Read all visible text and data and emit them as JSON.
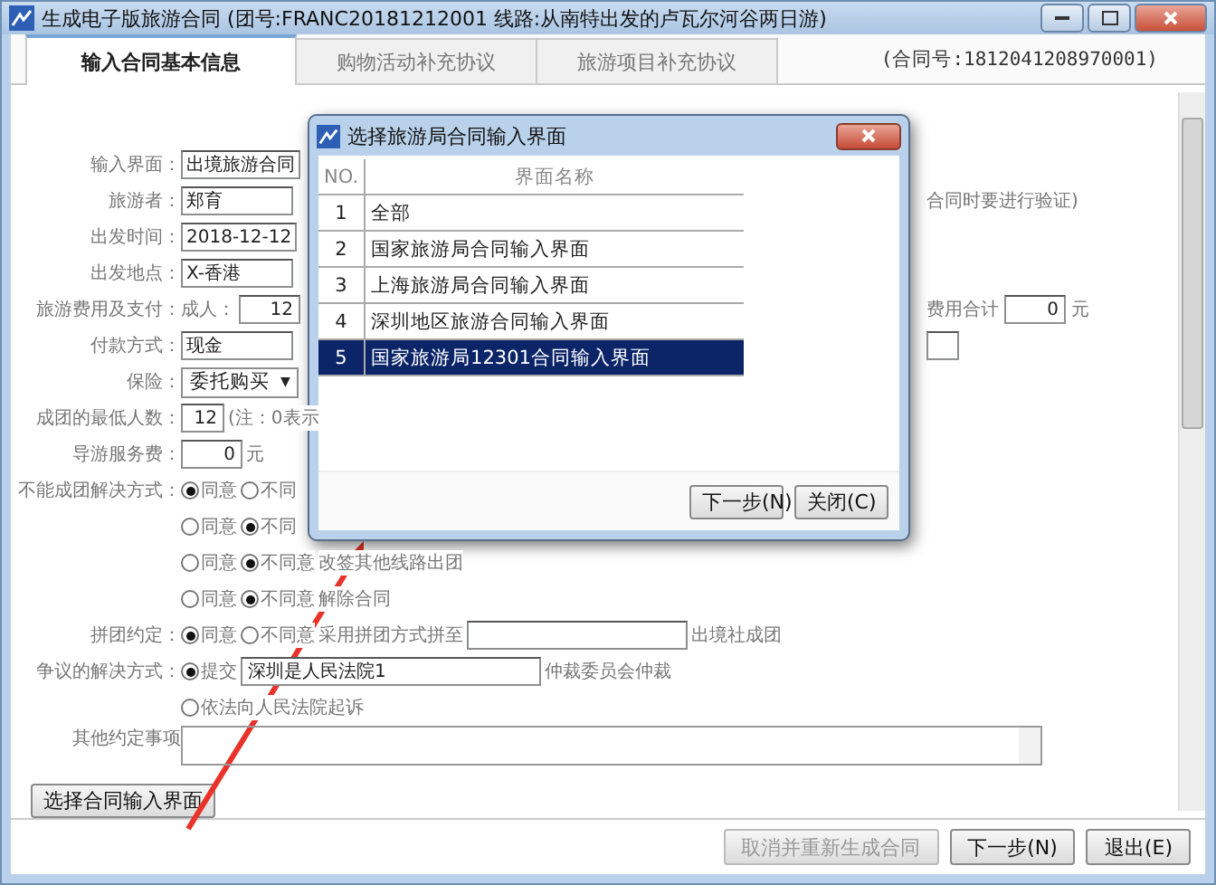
{
  "window": {
    "title": "生成电子版旅游合同 (团号:FRANC20181212001  线路:从南特出发的卢瓦尔河谷两日游)"
  },
  "tabs": [
    {
      "label": "输入合同基本信息",
      "selected": true
    },
    {
      "label": "购物活动补充协议",
      "selected": false
    },
    {
      "label": "旅游项目补充协议",
      "selected": false
    }
  ],
  "contract_no": "(合同号:1812041208970001)",
  "form": {
    "rows": [
      {
        "label": "输入界面：",
        "items": [
          {
            "kind": "field",
            "value": "出境旅游合同"
          }
        ]
      },
      {
        "label": "旅游者：",
        "items": [
          {
            "kind": "field",
            "value": "郑育"
          }
        ],
        "right": [
          {
            "kind": "text",
            "text": "合同时要进行验证)"
          }
        ]
      },
      {
        "label": "出发时间：",
        "items": [
          {
            "kind": "field",
            "value": "2018-12-12"
          }
        ]
      },
      {
        "label": "出发地点：",
        "items": [
          {
            "kind": "field",
            "value": "X-香港"
          }
        ]
      },
      {
        "label": "旅游费用及支付：",
        "items": [
          {
            "kind": "text",
            "text": "成人："
          },
          {
            "kind": "numfield",
            "value": "12"
          }
        ],
        "right": [
          {
            "kind": "text",
            "text": "费用合计"
          },
          {
            "kind": "numfield",
            "value": "0"
          },
          {
            "kind": "text",
            "text": "元"
          }
        ]
      },
      {
        "label": "付款方式：",
        "items": [
          {
            "kind": "field",
            "value": "现金"
          }
        ],
        "right": [
          {
            "kind": "emptybox"
          }
        ]
      },
      {
        "label": "保险：",
        "items": [
          {
            "kind": "select",
            "value": "委托购买",
            "arrow": "▼"
          }
        ]
      },
      {
        "label": "成团的最低人数：",
        "items": [
          {
            "kind": "tinyfield",
            "value": "12"
          },
          {
            "kind": "text",
            "text": "(注：0表示"
          }
        ]
      },
      {
        "label": "导游服务费：",
        "items": [
          {
            "kind": "numfield",
            "value": "0"
          },
          {
            "kind": "text",
            "text": "元"
          }
        ]
      },
      {
        "label": "不能成团解决方式：",
        "items": [
          {
            "kind": "radio",
            "label": "同意",
            "selected": true
          },
          {
            "kind": "radio",
            "label": "不同",
            "selected": false
          }
        ]
      },
      {
        "items": [
          {
            "kind": "radio",
            "label": "同意",
            "selected": false
          },
          {
            "kind": "radio",
            "label": "不同",
            "selected": true
          }
        ]
      },
      {
        "items": [
          {
            "kind": "radio",
            "label": "同意",
            "selected": false
          },
          {
            "kind": "radio",
            "label": "不同意",
            "selected": true
          },
          {
            "kind": "text",
            "text": "改签其他线路出团"
          }
        ]
      },
      {
        "items": [
          {
            "kind": "radio",
            "label": "同意",
            "selected": false
          },
          {
            "kind": "radio",
            "label": "不同意",
            "selected": true
          },
          {
            "kind": "text",
            "text": "解除合同"
          }
        ]
      },
      {
        "label": "拼团约定：",
        "items": [
          {
            "kind": "radio",
            "label": "同意",
            "selected": true
          },
          {
            "kind": "radio",
            "label": "不同意",
            "selected": false
          },
          {
            "kind": "text",
            "text": "采用拼团方式拼至"
          },
          {
            "kind": "longfield",
            "value": ""
          },
          {
            "kind": "text",
            "text": "出境社成团"
          }
        ]
      },
      {
        "label": "争议的解决方式：",
        "items": [
          {
            "kind": "radio",
            "label": "提交",
            "selected": true
          },
          {
            "kind": "longfield",
            "value": "深圳是人民法院1"
          },
          {
            "kind": "text",
            "text": "仲裁委员会仲裁"
          }
        ]
      },
      {
        "items": [
          {
            "kind": "radio",
            "label": "依法向人民法院起诉",
            "selected": false
          }
        ]
      },
      {
        "label": "其他约定事项",
        "items": [
          {
            "kind": "textarea",
            "value": ""
          }
        ]
      }
    ]
  },
  "select_button": "选择合同输入界面",
  "footer_buttons": [
    {
      "label": "取消并重新生成合同",
      "disabled": true
    },
    {
      "label": "下一步(N)",
      "disabled": false
    },
    {
      "label": "退出(E)",
      "disabled": false
    }
  ],
  "dialog": {
    "title": "选择旅游局合同输入界面",
    "columns": [
      "NO.",
      "界面名称"
    ],
    "rows": [
      {
        "no": "1",
        "name": "全部",
        "selected": false
      },
      {
        "no": "2",
        "name": "国家旅游局合同输入界面",
        "selected": false
      },
      {
        "no": "3",
        "name": "上海旅游局合同输入界面",
        "selected": false
      },
      {
        "no": "4",
        "name": "深圳地区旅游合同输入界面",
        "selected": false
      },
      {
        "no": "5",
        "name": "国家旅游局12301合同输入界面",
        "selected": true
      }
    ],
    "buttons": [
      "下一步(N)",
      "关闭(C)"
    ]
  }
}
